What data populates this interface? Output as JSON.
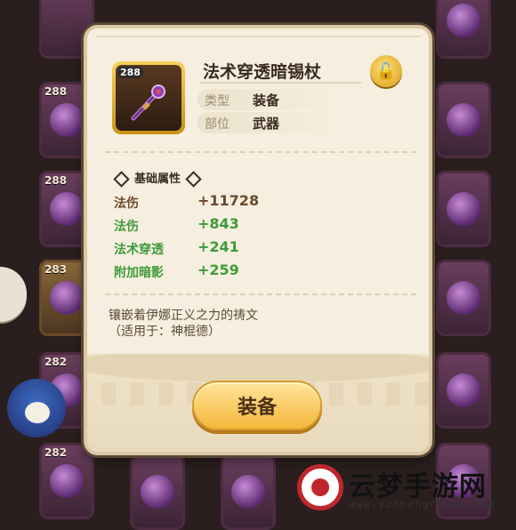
{
  "background_slots": [
    {
      "level": "288"
    },
    {
      "level": "288"
    },
    {
      "level": "283"
    },
    {
      "level": "282"
    },
    {
      "level": "282"
    }
  ],
  "item": {
    "level": "288",
    "name": "法术穿透暗锡杖",
    "type_label": "类型",
    "type_value": "装备",
    "slot_label": "部位",
    "slot_value": "武器"
  },
  "section_title": "基础属性",
  "stats": [
    {
      "name": "法伤",
      "value": "+11728",
      "color": "#6a4a2e"
    },
    {
      "name": "法伤",
      "value": "+843",
      "color": "#3f9a3a"
    },
    {
      "name": "法术穿透",
      "value": "+241",
      "color": "#3f9a3a"
    },
    {
      "name": "附加暗影",
      "value": "+259",
      "color": "#3f9a3a"
    }
  ],
  "description": {
    "line1": "镶嵌着伊娜正义之力的祷文",
    "line2": "（适用于：神棍德）"
  },
  "equip_button": "装备",
  "watermark": {
    "text": "云梦手游网",
    "url": "www.yunmengchina.com"
  },
  "colors": {
    "accent": "#f4b73a",
    "bonus": "#3f9a3a",
    "lock": "#d99b16"
  },
  "icons": {
    "lock": "lock-icon",
    "staff": "magic-staff-icon"
  }
}
